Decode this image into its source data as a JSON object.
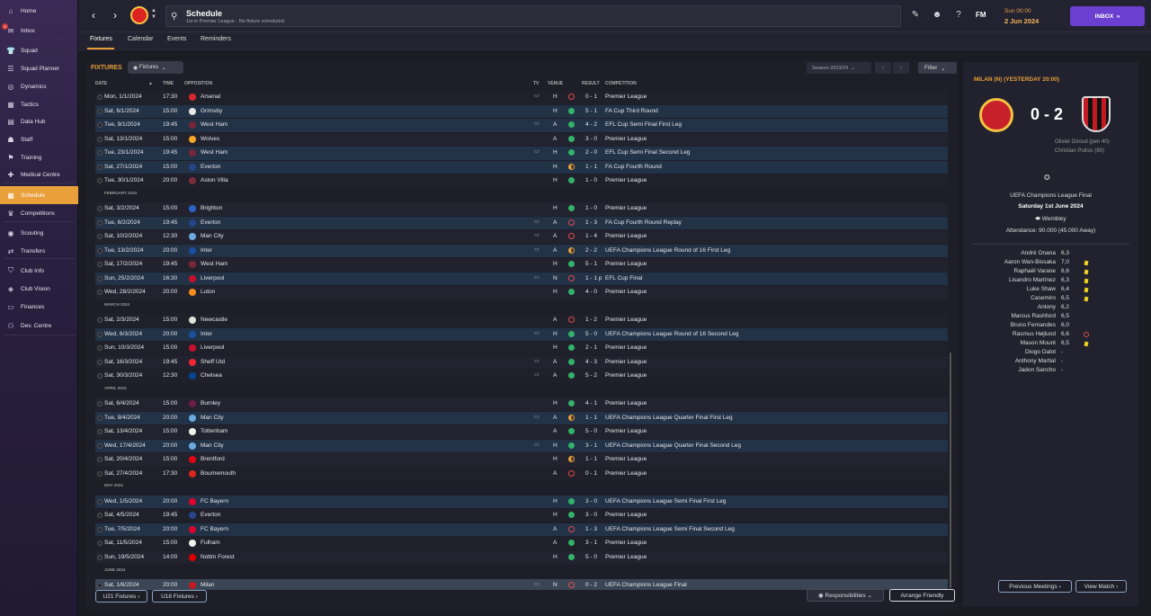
{
  "sidebar": {
    "items": [
      {
        "label": "Home",
        "icon": "home-icon",
        "glyph": "⌂"
      },
      {
        "label": "Inbox",
        "icon": "inbox-icon",
        "glyph": "✉",
        "badge": "2"
      },
      {
        "label": "Squad",
        "icon": "squad-icon",
        "glyph": "👕"
      },
      {
        "label": "Squad Planner",
        "icon": "squad-planner-icon",
        "glyph": "☰"
      },
      {
        "label": "Dynamics",
        "icon": "dynamics-icon",
        "glyph": "◎"
      },
      {
        "label": "Tactics",
        "icon": "tactics-icon",
        "glyph": "▦"
      },
      {
        "label": "Data Hub",
        "icon": "data-hub-icon",
        "glyph": "▤"
      },
      {
        "label": "Staff",
        "icon": "staff-icon",
        "glyph": "☗"
      },
      {
        "label": "Training",
        "icon": "training-icon",
        "glyph": "⚑"
      },
      {
        "label": "Medical Centre",
        "icon": "medical-icon",
        "glyph": "✚"
      },
      {
        "label": "Schedule",
        "icon": "schedule-icon",
        "glyph": "▦",
        "active": true
      },
      {
        "label": "Competitions",
        "icon": "trophy-icon",
        "glyph": "♛"
      },
      {
        "label": "Scouting",
        "icon": "scouting-icon",
        "glyph": "◉"
      },
      {
        "label": "Transfers",
        "icon": "transfers-icon",
        "glyph": "⇄"
      },
      {
        "label": "Club Info",
        "icon": "shield-icon",
        "glyph": "⛉"
      },
      {
        "label": "Club Vision",
        "icon": "club-vision-icon",
        "glyph": "◈"
      },
      {
        "label": "Finances",
        "icon": "finances-icon",
        "glyph": "▭"
      },
      {
        "label": "Dev. Centre",
        "icon": "dev-centre-icon",
        "glyph": "⚇"
      }
    ]
  },
  "header": {
    "title": "Schedule",
    "subtitle": "1st in Premier League - No fixture scheduled.",
    "fm_logo": "FM",
    "time": "Sun 00:00",
    "date": "2 Jun 2024",
    "inbox_label": "INBOX"
  },
  "tabs": [
    "Fixtures",
    "Calendar",
    "Events",
    "Reminders"
  ],
  "fixtures_panel": {
    "title": "FIXTURES",
    "dropdown": "Fixtures",
    "season": "Season 2023/24",
    "filter": "Filter",
    "columns": {
      "date": "DATE",
      "time": "TIME",
      "opposition": "OPPOSITION",
      "tv": "TV",
      "venue": "VENUE",
      "result": "RESULT",
      "competition": "COMPETITION"
    },
    "months": {
      "feb": "FEBRUARY 2024",
      "mar": "MARCH 2024",
      "apr": "APRIL 2024",
      "may": "MAY 2024",
      "jun": "JUNE 2024"
    },
    "rows": [
      {
        "date": "Mon, 1/1/2024",
        "time": "17:30",
        "opp": "Arsenal",
        "crest": "#d8262f",
        "tv": true,
        "venue": "H",
        "outcome": "loss",
        "result": "0 - 1",
        "comp": "Premier League",
        "home": false
      },
      {
        "date": "Sat, 6/1/2024",
        "time": "15:00",
        "opp": "Grimsby",
        "crest": "#e6e6e6",
        "tv": false,
        "venue": "H",
        "outcome": "win",
        "result": "5 - 1",
        "comp": "FA Cup Third Round",
        "home": true
      },
      {
        "date": "Tue, 9/1/2024",
        "time": "19:45",
        "opp": "West Ham",
        "crest": "#7a263a",
        "tv": true,
        "venue": "A",
        "outcome": "win",
        "result": "4 - 2",
        "comp": "EFL Cup Semi Final First Leg",
        "home": true
      },
      {
        "date": "Sat, 13/1/2024",
        "time": "15:00",
        "opp": "Wolves",
        "crest": "#f5a623",
        "tv": false,
        "venue": "A",
        "outcome": "win",
        "result": "3 - 0",
        "comp": "Premier League",
        "home": false
      },
      {
        "date": "Tue, 23/1/2024",
        "time": "19:45",
        "opp": "West Ham",
        "crest": "#7a263a",
        "tv": true,
        "venue": "H",
        "outcome": "win",
        "result": "2 - 0",
        "comp": "EFL Cup Semi Final Second Leg",
        "home": true
      },
      {
        "date": "Sat, 27/1/2024",
        "time": "15:00",
        "opp": "Everton",
        "crest": "#274488",
        "tv": false,
        "venue": "H",
        "outcome": "draw",
        "result": "1 - 1",
        "comp": "FA Cup Fourth Round",
        "home": true
      },
      {
        "date": "Tue, 30/1/2024",
        "time": "20:00",
        "opp": "Aston Villa",
        "crest": "#7c2c3b",
        "tv": false,
        "venue": "H",
        "outcome": "win",
        "result": "1 - 0",
        "comp": "Premier League",
        "home": false
      },
      {
        "date": "Sat, 3/2/2024",
        "time": "15:00",
        "opp": "Brighton",
        "crest": "#2b64c8",
        "tv": false,
        "venue": "H",
        "outcome": "win",
        "result": "1 - 0",
        "comp": "Premier League",
        "home": false
      },
      {
        "date": "Tue, 6/2/2024",
        "time": "19:45",
        "opp": "Everton",
        "crest": "#274488",
        "tv": true,
        "venue": "A",
        "outcome": "loss",
        "result": "1 - 3",
        "comp": "FA Cup Fourth Round Replay",
        "home": true
      },
      {
        "date": "Sat, 10/2/2024",
        "time": "12:30",
        "opp": "Man City",
        "crest": "#6cabdd",
        "tv": true,
        "venue": "A",
        "outcome": "loss",
        "result": "1 - 4",
        "comp": "Premier League",
        "home": false
      },
      {
        "date": "Tue, 13/2/2024",
        "time": "20:00",
        "opp": "Inter",
        "crest": "#1a4fa0",
        "tv": true,
        "venue": "A",
        "outcome": "draw",
        "result": "2 - 2",
        "comp": "UEFA Champions League Round of 16 First Leg",
        "home": true
      },
      {
        "date": "Sat, 17/2/2024",
        "time": "19:45",
        "opp": "West Ham",
        "crest": "#7a263a",
        "tv": false,
        "venue": "H",
        "outcome": "win",
        "result": "5 - 1",
        "comp": "Premier League",
        "home": false
      },
      {
        "date": "Sun, 25/2/2024",
        "time": "16:30",
        "opp": "Liverpool",
        "crest": "#c8102e",
        "tv": true,
        "venue": "N",
        "outcome": "loss",
        "result": "1 - 1 p",
        "comp": "EFL Cup Final",
        "home": true
      },
      {
        "date": "Wed, 28/2/2024",
        "time": "20:00",
        "opp": "Luton",
        "crest": "#f78f1e",
        "tv": false,
        "venue": "H",
        "outcome": "win",
        "result": "4 - 0",
        "comp": "Premier League",
        "home": false
      },
      {
        "date": "Sat, 2/3/2024",
        "time": "15:00",
        "opp": "Newcastle",
        "crest": "#e0e0e0",
        "tv": false,
        "venue": "A",
        "outcome": "loss",
        "result": "1 - 2",
        "comp": "Premier League",
        "home": false
      },
      {
        "date": "Wed, 6/3/2024",
        "time": "20:00",
        "opp": "Inter",
        "crest": "#1a4fa0",
        "tv": true,
        "venue": "H",
        "outcome": "win",
        "result": "5 - 0",
        "comp": "UEFA Champions League Round of 16 Second Leg",
        "home": true
      },
      {
        "date": "Sun, 10/3/2024",
        "time": "15:00",
        "opp": "Liverpool",
        "crest": "#c8102e",
        "tv": false,
        "venue": "H",
        "outcome": "win",
        "result": "2 - 1",
        "comp": "Premier League",
        "home": false
      },
      {
        "date": "Sat, 16/3/2024",
        "time": "19:45",
        "opp": "Sheff Utd",
        "crest": "#ee2737",
        "tv": true,
        "venue": "A",
        "outcome": "win",
        "result": "4 - 3",
        "comp": "Premier League",
        "home": false
      },
      {
        "date": "Sat, 30/3/2024",
        "time": "12:30",
        "opp": "Chelsea",
        "crest": "#034694",
        "tv": true,
        "venue": "A",
        "outcome": "win",
        "result": "5 - 2",
        "comp": "Premier League",
        "home": false
      },
      {
        "date": "Sat, 6/4/2024",
        "time": "15:00",
        "opp": "Burnley",
        "crest": "#6c1d45",
        "tv": false,
        "venue": "H",
        "outcome": "win",
        "result": "4 - 1",
        "comp": "Premier League",
        "home": false
      },
      {
        "date": "Tue, 9/4/2024",
        "time": "20:00",
        "opp": "Man City",
        "crest": "#6cabdd",
        "tv": true,
        "venue": "A",
        "outcome": "draw",
        "result": "1 - 1",
        "comp": "UEFA Champions League Quarter Final First Leg",
        "home": true
      },
      {
        "date": "Sat, 13/4/2024",
        "time": "15:00",
        "opp": "Tottenham",
        "crest": "#f0f0f0",
        "tv": false,
        "venue": "A",
        "outcome": "win",
        "result": "5 - 0",
        "comp": "Premier League",
        "home": false
      },
      {
        "date": "Wed, 17/4/2024",
        "time": "20:00",
        "opp": "Man City",
        "crest": "#6cabdd",
        "tv": true,
        "venue": "H",
        "outcome": "win",
        "result": "3 - 1",
        "comp": "UEFA Champions League Quarter Final Second Leg",
        "home": true
      },
      {
        "date": "Sat, 20/4/2024",
        "time": "15:00",
        "opp": "Brentford",
        "crest": "#e30613",
        "tv": false,
        "venue": "H",
        "outcome": "draw",
        "result": "1 - 1",
        "comp": "Premier League",
        "home": false
      },
      {
        "date": "Sat, 27/4/2024",
        "time": "17:30",
        "opp": "Bournemouth",
        "crest": "#da291c",
        "tv": false,
        "venue": "A",
        "outcome": "loss",
        "result": "0 - 1",
        "comp": "Premier League",
        "home": false
      },
      {
        "date": "Wed, 1/5/2024",
        "time": "20:00",
        "opp": "FC Bayern",
        "crest": "#dc052d",
        "tv": false,
        "venue": "H",
        "outcome": "win",
        "result": "3 - 0",
        "comp": "UEFA Champions League Semi Final First Leg",
        "home": true
      },
      {
        "date": "Sat, 4/5/2024",
        "time": "19:45",
        "opp": "Everton",
        "crest": "#274488",
        "tv": false,
        "venue": "H",
        "outcome": "win",
        "result": "3 - 0",
        "comp": "Premier League",
        "home": false
      },
      {
        "date": "Tue, 7/5/2024",
        "time": "20:00",
        "opp": "FC Bayern",
        "crest": "#dc052d",
        "tv": false,
        "venue": "A",
        "outcome": "loss",
        "result": "1 - 3",
        "comp": "UEFA Champions League Semi Final Second Leg",
        "home": true
      },
      {
        "date": "Sat, 11/5/2024",
        "time": "15:00",
        "opp": "Fulham",
        "crest": "#f0f0f0",
        "tv": false,
        "venue": "A",
        "outcome": "win",
        "result": "3 - 1",
        "comp": "Premier League",
        "home": false
      },
      {
        "date": "Sun, 19/5/2024",
        "time": "14:00",
        "opp": "Nottm Forest",
        "crest": "#dd0000",
        "tv": false,
        "venue": "H",
        "outcome": "win",
        "result": "5 - 0",
        "comp": "Premier League",
        "home": false
      },
      {
        "date": "Sat, 1/6/2024",
        "time": "20:00",
        "opp": "Milan",
        "crest": "#c21a20",
        "tv": true,
        "venue": "N",
        "outcome": "loss",
        "result": "0 - 2",
        "comp": "UEFA Champions League Final",
        "home": false,
        "selected": true
      }
    ],
    "buttons": {
      "u21": "U21 Fixtures",
      "u18": "U18 Fixtures",
      "responsibilities": "Responsibilities",
      "arrange": "Arrange Friendly"
    }
  },
  "match_panel": {
    "heading": "MILAN (N) (YESTERDAY 20:00)",
    "score": "0 - 2",
    "scorers": [
      "Olivier Giroud (pen 40)",
      "Christian Pulisic (80)"
    ],
    "competition": "UEFA Champions League Final",
    "date": "Saturday 1st June 2024",
    "venue": "Wembley",
    "attendance": "Attendance: 90.000 (45.000 Away)",
    "lineup": [
      {
        "name": "André Onana",
        "rating": "6,3",
        "card": false,
        "sub": false
      },
      {
        "name": "Aaron Wan-Bissaka",
        "rating": "7,0",
        "card": true,
        "sub": false
      },
      {
        "name": "Raphaël Varane",
        "rating": "6,6",
        "card": true,
        "sub": false
      },
      {
        "name": "Lisandro Martínez",
        "rating": "6,3",
        "card": true,
        "sub": false
      },
      {
        "name": "Luke Shaw",
        "rating": "6,4",
        "card": true,
        "sub": false
      },
      {
        "name": "Casemiro",
        "rating": "6,5",
        "card": true,
        "sub": false
      },
      {
        "name": "Antony",
        "rating": "6,2",
        "card": false,
        "sub": false
      },
      {
        "name": "Marcus Rashford",
        "rating": "6,5",
        "card": false,
        "sub": false
      },
      {
        "name": "Bruno Fernandes",
        "rating": "6,0",
        "card": false,
        "sub": false
      },
      {
        "name": "Rasmus Højlund",
        "rating": "6,6",
        "card": false,
        "sub": true
      },
      {
        "name": "Mason Mount",
        "rating": "6,5",
        "card": true,
        "sub": false
      },
      {
        "name": "Diogo Dalot",
        "rating": "-",
        "card": false,
        "sub": false
      },
      {
        "name": "Anthony Martial",
        "rating": "-",
        "card": false,
        "sub": false
      },
      {
        "name": "Jadon Sancho",
        "rating": "-",
        "card": false,
        "sub": false
      }
    ],
    "buttons": {
      "previous": "Previous Meetings",
      "view": "View Match"
    }
  }
}
